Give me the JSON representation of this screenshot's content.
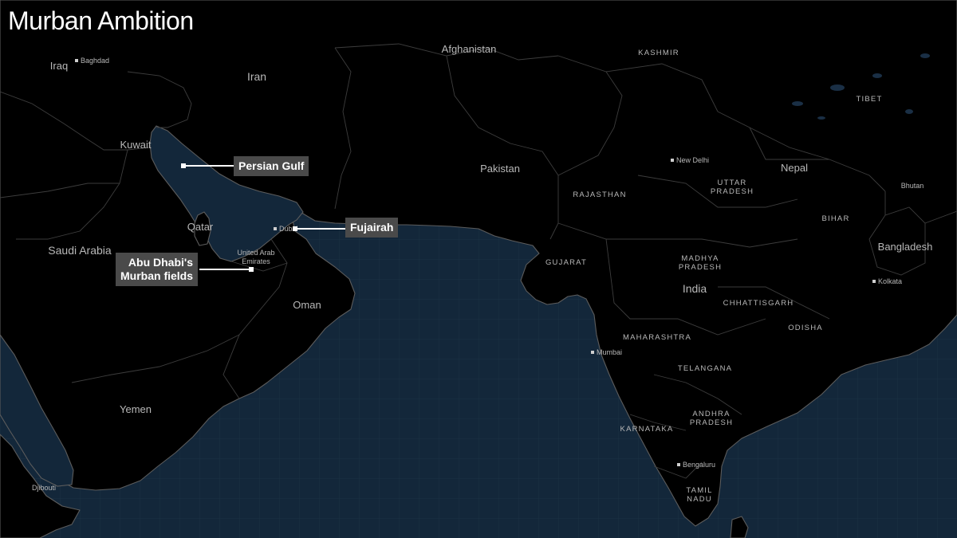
{
  "title": "Murban Ambition",
  "colors": {
    "background": "#000000",
    "sea": "#13273a",
    "grid": "#1d3347",
    "callout_bg": "#4a4a4a",
    "callout_text": "#ffffff"
  },
  "callouts": {
    "persian_gulf": "Persian Gulf",
    "fujairah": "Fujairah",
    "murban_line1": "Abu Dhabi's",
    "murban_line2": "Murban fields"
  },
  "countries": {
    "iraq": "Iraq",
    "iran": "Iran",
    "afghanistan": "Afghanistan",
    "kuwait": "Kuwait",
    "pakistan": "Pakistan",
    "saudi_arabia": "Saudi Arabia",
    "qatar": "Qatar",
    "uae_line1": "United Arab",
    "uae_line2": "Emirates",
    "oman": "Oman",
    "yemen": "Yemen",
    "djibouti": "Djibouti",
    "india": "India",
    "nepal": "Nepal",
    "bhutan": "Bhutan",
    "bangladesh": "Bangladesh"
  },
  "regions": {
    "kashmir": "KASHMIR",
    "tibet": "TIBET",
    "rajasthan": "RAJASTHAN",
    "uttar_pradesh_1": "UTTAR",
    "uttar_pradesh_2": "PRADESH",
    "bihar": "BIHAR",
    "gujarat": "GUJARAT",
    "madhya_pradesh_1": "MADHYA",
    "madhya_pradesh_2": "PRADESH",
    "chhattisgarh": "CHHATTISGARH",
    "odisha": "ODISHA",
    "maharashtra": "MAHARASHTRA",
    "telangana": "TELANGANA",
    "andhra_pradesh_1": "ANDHRA",
    "andhra_pradesh_2": "PRADESH",
    "karnataka": "KARNATAKA",
    "tamil_nadu_1": "TAMIL",
    "tamil_nadu_2": "NADU"
  },
  "cities": {
    "baghdad": "Baghdad",
    "new_delhi": "New Delhi",
    "dubai": "Dubai",
    "kolkata": "Kolkata",
    "mumbai": "Mumbai",
    "bengaluru": "Bengaluru"
  }
}
